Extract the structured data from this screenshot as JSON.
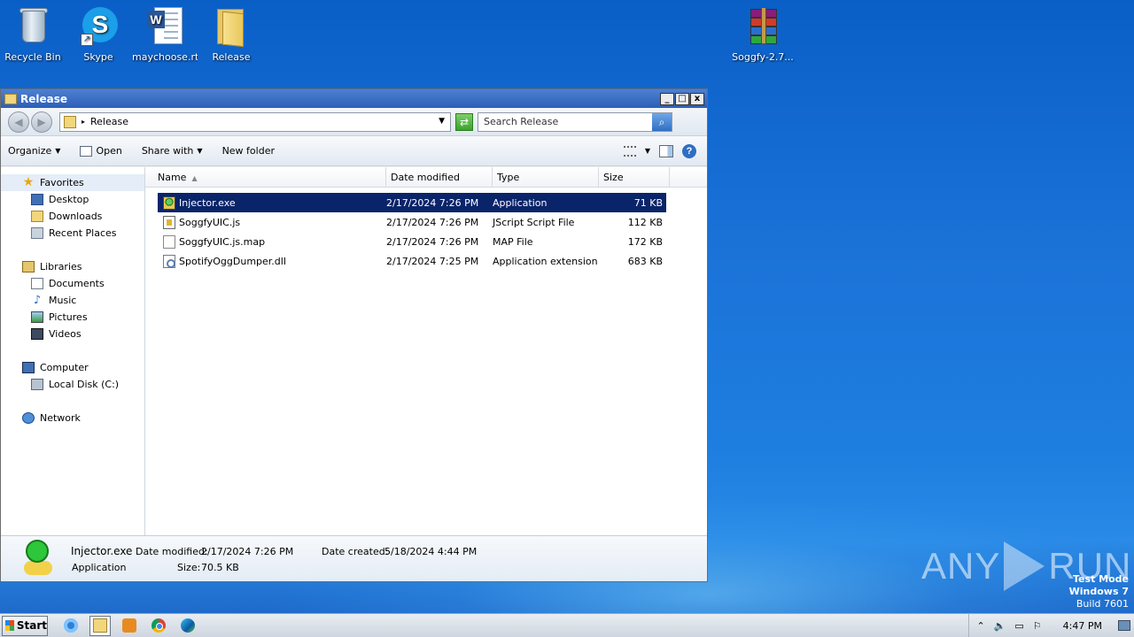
{
  "desktop": {
    "icons": [
      {
        "label": "Recycle Bin",
        "icon": "recycle-bin-icon"
      },
      {
        "label": "Skype",
        "icon": "skype-icon"
      },
      {
        "label": "maychoose.rtf",
        "icon": "word-document-icon"
      },
      {
        "label": "Release",
        "icon": "folder-icon"
      },
      {
        "label": "Soggfy-2.7...",
        "icon": "winrar-archive-icon"
      }
    ]
  },
  "window": {
    "title": "Release",
    "controls": {
      "minimize": "_",
      "maximize": "□",
      "close": "x"
    },
    "address": {
      "path": "Release"
    },
    "search": {
      "placeholder": "Search Release"
    },
    "toolbar": {
      "organize": "Organize",
      "open": "Open",
      "share_with": "Share with",
      "new_folder": "New folder"
    },
    "nav": {
      "favorites": "Favorites",
      "desktop": "Desktop",
      "downloads": "Downloads",
      "recent_places": "Recent Places",
      "libraries": "Libraries",
      "documents": "Documents",
      "music": "Music",
      "pictures": "Pictures",
      "videos": "Videos",
      "computer": "Computer",
      "local_disk": "Local Disk (C:)",
      "network": "Network"
    },
    "columns": {
      "name": "Name",
      "date_modified": "Date modified",
      "type": "Type",
      "size": "Size"
    },
    "files": [
      {
        "name": "Injector.exe",
        "date": "2/17/2024 7:26 PM",
        "type": "Application",
        "size": "71 KB",
        "icon": "exe-icon",
        "selected": true
      },
      {
        "name": "SoggfyUIC.js",
        "date": "2/17/2024 7:26 PM",
        "type": "JScript Script File",
        "size": "112 KB",
        "icon": "js-file-icon",
        "selected": false
      },
      {
        "name": "SoggfyUIC.js.map",
        "date": "2/17/2024 7:26 PM",
        "type": "MAP File",
        "size": "172 KB",
        "icon": "map-file-icon",
        "selected": false
      },
      {
        "name": "SpotifyOggDumper.dll",
        "date": "2/17/2024 7:25 PM",
        "type": "Application extension",
        "size": "683 KB",
        "icon": "dll-file-icon",
        "selected": false
      }
    ],
    "details": {
      "name": "Injector.exe",
      "modified_label": "Date modified:",
      "modified_value": "2/17/2024 7:26 PM",
      "created_label": "Date created:",
      "created_value": "5/18/2024 4:44 PM",
      "type": "Application",
      "size_label": "Size:",
      "size_value": "70.5 KB"
    }
  },
  "watermark": {
    "left": "ANY",
    "right": "RUN"
  },
  "test_mode": {
    "line1": "Test Mode",
    "line2": "Windows 7",
    "line3": "Build 7601"
  },
  "taskbar": {
    "start": "Start",
    "apps": [
      "internet-explorer-icon",
      "windows-explorer-icon",
      "media-player-icon",
      "chrome-icon",
      "edge-icon"
    ],
    "clock": "4:47 PM"
  }
}
